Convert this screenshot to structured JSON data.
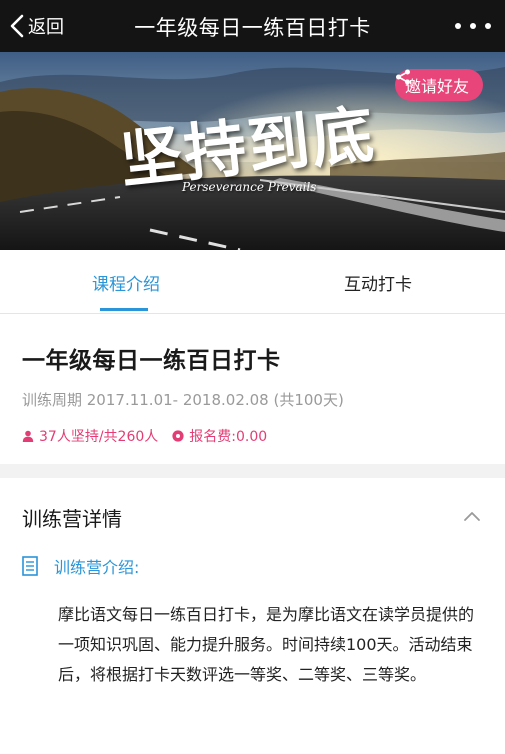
{
  "nav": {
    "back_label": "返回",
    "title": "一年级每日一练百日打卡"
  },
  "hero": {
    "title": "坚持到底",
    "subtitle": "Perseverance Prevails",
    "invite_label": "邀请好友"
  },
  "tabs": [
    {
      "label": "课程介绍",
      "active": true
    },
    {
      "label": "互动打卡",
      "active": false
    }
  ],
  "course": {
    "title": "一年级每日一练百日打卡",
    "period": "训练周期 2017.11.01- 2018.02.08 (共100天)",
    "participants": "37人坚持/共260人",
    "fee": "报名费:0.00"
  },
  "details": {
    "header": "训练营详情",
    "intro_label": "训练营介绍:",
    "description": "摩比语文每日一练百日打卡，是为摩比语文在读学员提供的一项知识巩固、能力提升服务。时间持续100天。活动结束后，将根据打卡天数评选一等奖、二等奖、三等奖。"
  },
  "colors": {
    "accent_blue": "#2a95d8",
    "accent_pink": "#e23e75",
    "invite_pink": "#e8457a",
    "navbar": "#141414"
  },
  "icons": [
    "back-chevron-icon",
    "more-icon",
    "share-icon",
    "person-icon",
    "fee-icon",
    "chevron-up-icon",
    "document-icon"
  ]
}
